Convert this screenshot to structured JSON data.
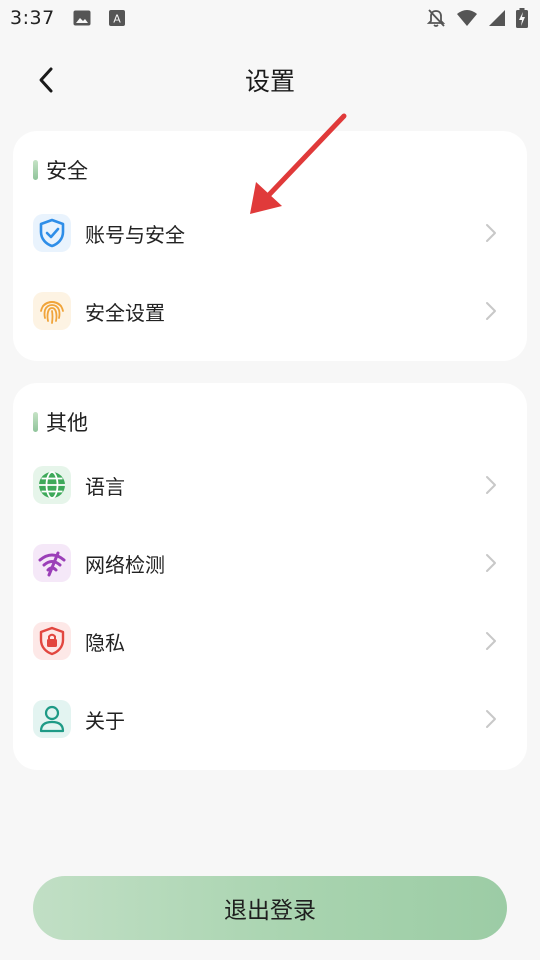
{
  "status_bar": {
    "time": "3:37",
    "icons": [
      "image-icon",
      "text-badge-icon",
      "notifications-off-icon",
      "wifi-icon",
      "signal-icon",
      "battery-charging-icon"
    ],
    "badge_letter": "A"
  },
  "header": {
    "title": "设置",
    "back_icon": "chevron-left-icon"
  },
  "sections": {
    "security": {
      "title": "安全",
      "items": [
        {
          "label": "账号与安全",
          "icon": "shield-check-icon",
          "color": "#2f8ee8"
        },
        {
          "label": "安全设置",
          "icon": "fingerprint-icon",
          "color": "#f0a43a"
        }
      ]
    },
    "other": {
      "title": "其他",
      "items": [
        {
          "label": "语言",
          "icon": "globe-icon",
          "color": "#3ea95a"
        },
        {
          "label": "网络检测",
          "icon": "wifi-slash-icon",
          "color": "#9b3fb8"
        },
        {
          "label": "隐私",
          "icon": "privacy-lock-icon",
          "color": "#e2463f"
        },
        {
          "label": "关于",
          "icon": "user-icon",
          "color": "#1e9a86"
        }
      ]
    }
  },
  "logout": {
    "label": "退出登录"
  },
  "colors": {
    "background": "#f7f7f7",
    "card": "#ffffff",
    "accent_green": "#9ccca5",
    "annotation_arrow": "#e03a3a"
  }
}
